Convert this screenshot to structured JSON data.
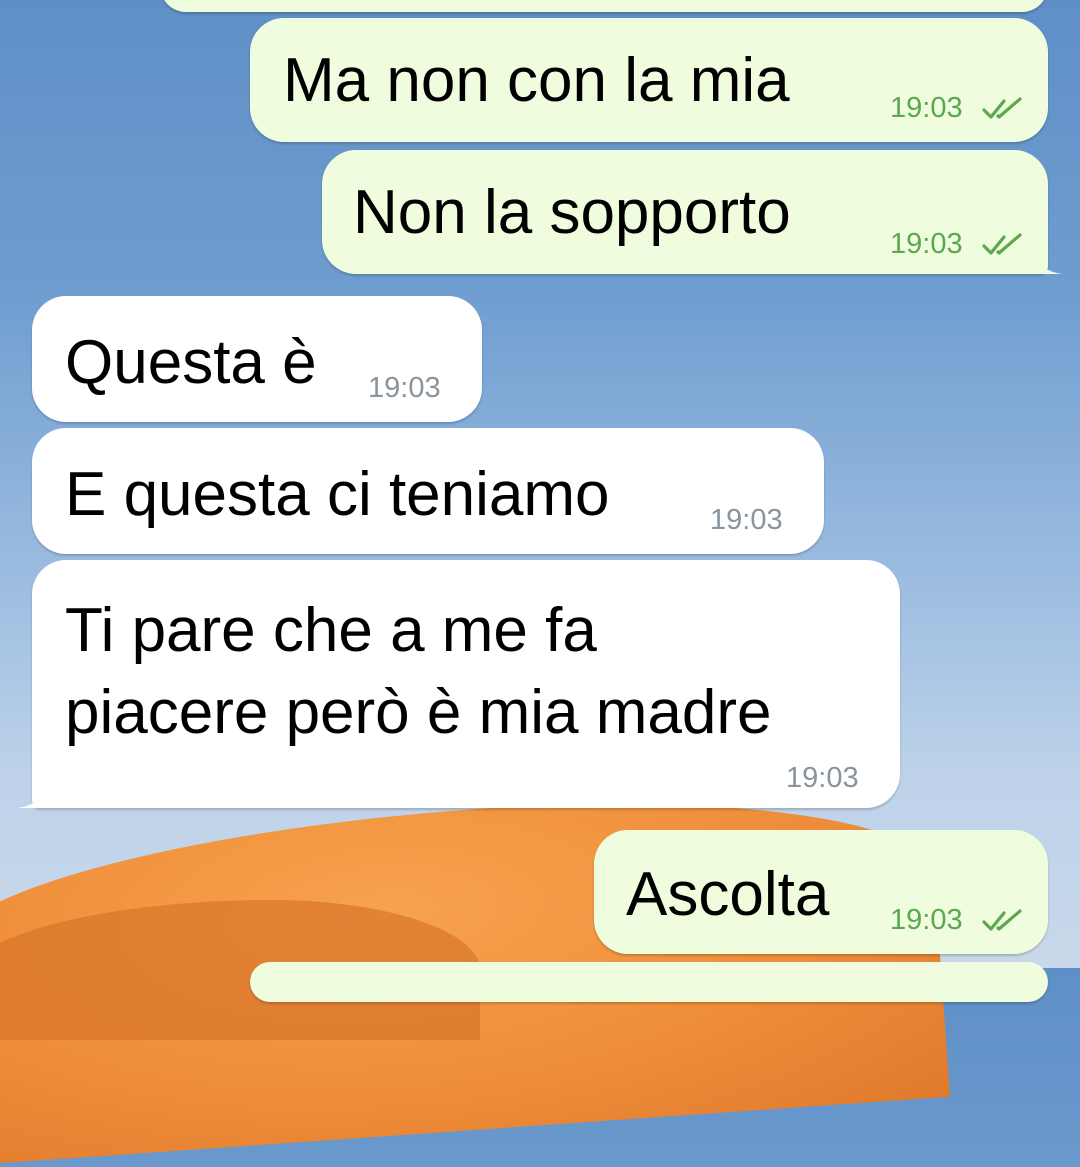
{
  "chat": {
    "messages": [
      {
        "direction": "outgoing",
        "text": "Ma non con la mia",
        "time": "19:03",
        "status": "read"
      },
      {
        "direction": "outgoing",
        "text": "Non la sopporto",
        "time": "19:03",
        "status": "read"
      },
      {
        "direction": "incoming",
        "text": "Questa è",
        "time": "19:03"
      },
      {
        "direction": "incoming",
        "text": "E questa ci teniamo",
        "time": "19:03"
      },
      {
        "direction": "incoming",
        "text": "Ti pare che a me fa\npiacere però è mia madre",
        "time": "19:03"
      },
      {
        "direction": "outgoing",
        "text": "Ascolta",
        "time": "19:03",
        "status": "read"
      }
    ]
  },
  "colors": {
    "outgoing_bubble": "#effdde",
    "incoming_bubble": "#ffffff",
    "outgoing_time": "#5ba84e",
    "incoming_time": "#8a949c"
  },
  "icons": {
    "read_status": "double-check-icon"
  }
}
